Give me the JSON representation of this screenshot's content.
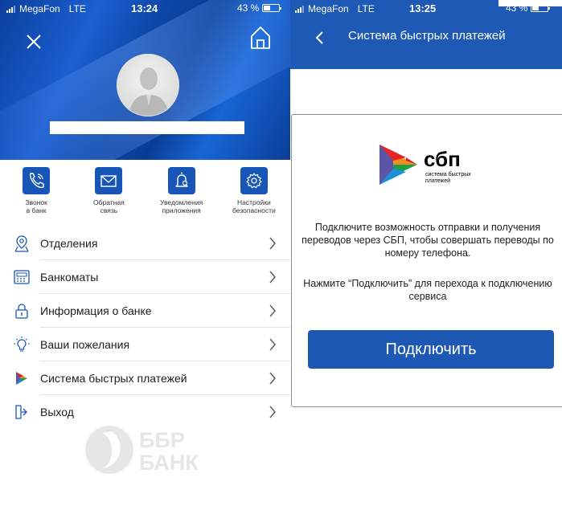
{
  "left_screen": {
    "status": {
      "carrier": "MegaFon",
      "network": "LTE",
      "time": "13:24",
      "battery": "43 %",
      "battery_level": 0.43
    },
    "header": {
      "close_icon": "close-icon",
      "home_icon": "home-icon",
      "avatar_icon": "avatar-silhouette"
    },
    "quick_actions": [
      {
        "label": "Звонок\nв банк",
        "icon": "phone-icon"
      },
      {
        "label": "Обратная\nсвязь",
        "icon": "mail-icon"
      },
      {
        "label": "Уведомления\nприложения",
        "icon": "bell-icon"
      },
      {
        "label": "Настройки\nбезопасности",
        "icon": "gear-icon"
      }
    ],
    "menu": [
      {
        "label": "Отделения",
        "icon": "location-pin-icon"
      },
      {
        "label": "Банкоматы",
        "icon": "atm-icon"
      },
      {
        "label": "Информация о банке",
        "icon": "lock-info-icon"
      },
      {
        "label": "Ваши пожелания",
        "icon": "lightbulb-icon"
      },
      {
        "label": "Система быстрых платежей",
        "icon": "sbp-icon"
      },
      {
        "label": "Выход",
        "icon": "exit-icon"
      }
    ],
    "watermark": {
      "line1": "ББР",
      "line2": "БАНК"
    }
  },
  "right_screen": {
    "status": {
      "carrier": "MegaFon",
      "network": "LTE",
      "time": "13:25",
      "battery": "43 %",
      "battery_level": 0.43
    },
    "title": "Система быстрых платежей",
    "logo": {
      "name": "сбп",
      "sub1": "система быстрых",
      "sub2": "платежей"
    },
    "text1": "Подключите возможность отправки и получения переводов через СБП, чтобы совершать переводы по номеру телефона.",
    "text2": "Нажмите “Подключить” для перехода к подключению сервиса",
    "button": "Подключить"
  },
  "colors": {
    "brand_blue": "#1e59b5",
    "icon_blue": "#1756b7",
    "watermark_gray": "#e6e6e6"
  }
}
